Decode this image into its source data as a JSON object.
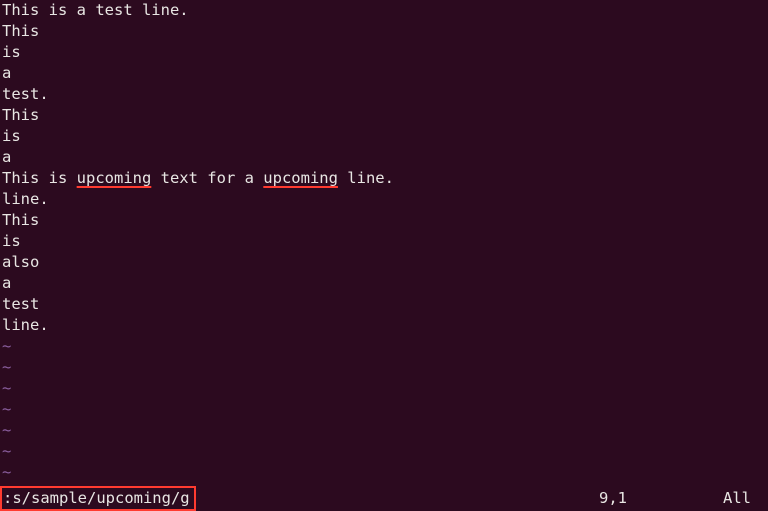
{
  "buffer": {
    "lines": [
      {
        "type": "text",
        "segments": [
          {
            "t": "This is a test line."
          }
        ]
      },
      {
        "type": "text",
        "segments": [
          {
            "t": "This"
          }
        ]
      },
      {
        "type": "text",
        "segments": [
          {
            "t": "is"
          }
        ]
      },
      {
        "type": "text",
        "segments": [
          {
            "t": "a"
          }
        ]
      },
      {
        "type": "text",
        "segments": [
          {
            "t": "test."
          }
        ]
      },
      {
        "type": "text",
        "segments": [
          {
            "t": "This"
          }
        ]
      },
      {
        "type": "text",
        "segments": [
          {
            "t": "is"
          }
        ]
      },
      {
        "type": "text",
        "segments": [
          {
            "t": "a"
          }
        ]
      },
      {
        "type": "text",
        "segments": [
          {
            "t": "This is "
          },
          {
            "t": "upcoming",
            "underline": true
          },
          {
            "t": " text for a "
          },
          {
            "t": "upcoming",
            "underline": true
          },
          {
            "t": " line."
          }
        ]
      },
      {
        "type": "text",
        "segments": [
          {
            "t": "line."
          }
        ]
      },
      {
        "type": "text",
        "segments": [
          {
            "t": "This"
          }
        ]
      },
      {
        "type": "text",
        "segments": [
          {
            "t": "is"
          }
        ]
      },
      {
        "type": "text",
        "segments": [
          {
            "t": "also"
          }
        ]
      },
      {
        "type": "text",
        "segments": [
          {
            "t": "a"
          }
        ]
      },
      {
        "type": "text",
        "segments": [
          {
            "t": "test"
          }
        ]
      },
      {
        "type": "text",
        "segments": [
          {
            "t": "line."
          }
        ]
      },
      {
        "type": "tilde",
        "segments": [
          {
            "t": "~"
          }
        ]
      },
      {
        "type": "tilde",
        "segments": [
          {
            "t": "~"
          }
        ]
      },
      {
        "type": "tilde",
        "segments": [
          {
            "t": "~"
          }
        ]
      },
      {
        "type": "tilde",
        "segments": [
          {
            "t": "~"
          }
        ]
      },
      {
        "type": "tilde",
        "segments": [
          {
            "t": "~"
          }
        ]
      },
      {
        "type": "tilde",
        "segments": [
          {
            "t": "~"
          }
        ]
      },
      {
        "type": "tilde",
        "segments": [
          {
            "t": "~"
          }
        ]
      }
    ]
  },
  "status": {
    "command": ":s/sample/upcoming/g",
    "position": "9,1",
    "percent": "All"
  }
}
